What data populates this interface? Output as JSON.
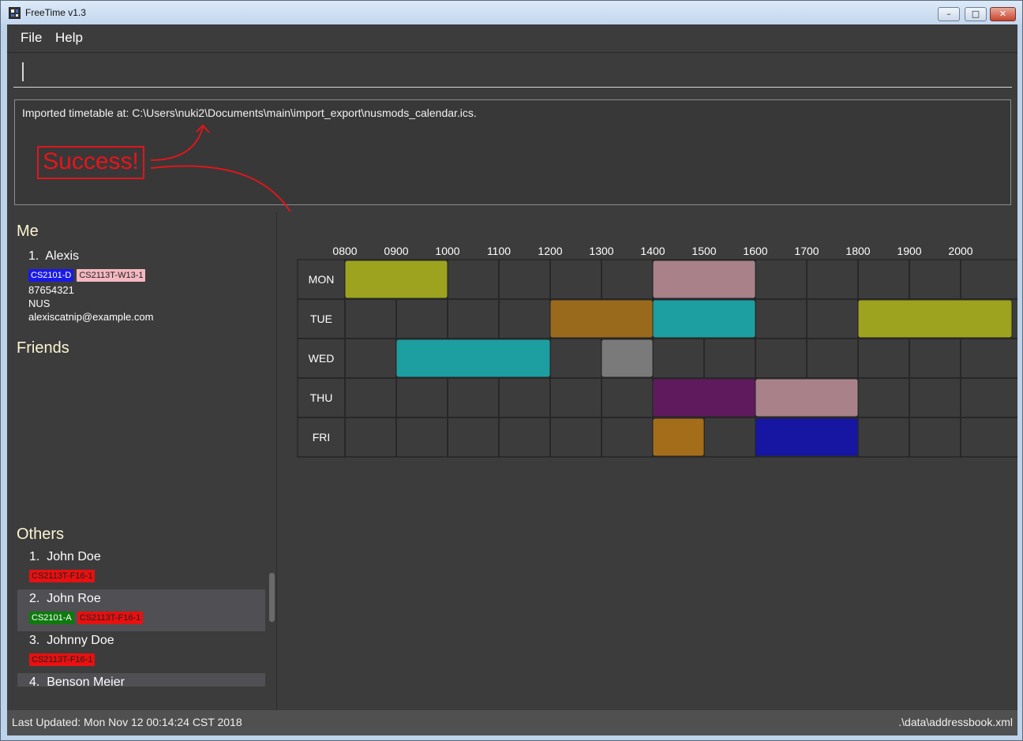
{
  "window": {
    "title": "FreeTime v1.3",
    "min_symbol": "–",
    "max_symbol": "□",
    "close_symbol": "✕"
  },
  "menu": {
    "file": "File",
    "help": "Help"
  },
  "command_box": {
    "value": ""
  },
  "result": {
    "text": "Imported timetable at: C:\\Users\\nuki2\\Documents\\main\\import_export\\nusmods_calendar.ics.",
    "annotation": "Success!",
    "annotation_color": "#e0161c"
  },
  "me": {
    "title": "Me",
    "index": "1.",
    "name": "Alexis",
    "tags": [
      {
        "label": "CS2101-D",
        "bg": "#1a1ae6",
        "fg": "#ffffff"
      },
      {
        "label": "CS2113T-W13-1",
        "bg": "#f4b8c0",
        "fg": "#222222"
      }
    ],
    "phone": "87654321",
    "address": "NUS",
    "email": "alexiscatnip@example.com"
  },
  "friends": {
    "title": "Friends"
  },
  "others": {
    "title": "Others",
    "list": [
      {
        "index": "1.",
        "name": "John Doe",
        "tags": [
          {
            "label": "CS2113T-F16-1",
            "bg": "#e81010",
            "fg": "#222222"
          }
        ]
      },
      {
        "index": "2.",
        "name": "John Roe",
        "tags": [
          {
            "label": "CS2101-A",
            "bg": "#0e7a0e",
            "fg": "#ffffff"
          },
          {
            "label": "CS2113T-F16-1",
            "bg": "#e81010",
            "fg": "#222222"
          }
        ]
      },
      {
        "index": "3.",
        "name": "Johnny Doe",
        "tags": [
          {
            "label": "CS2113T-F16-1",
            "bg": "#e81010",
            "fg": "#222222"
          }
        ]
      },
      {
        "index": "4.",
        "name": "Benson Meier",
        "tags": []
      }
    ]
  },
  "timetable": {
    "hours": [
      "0800",
      "0900",
      "1000",
      "1100",
      "1200",
      "1300",
      "1400",
      "1500",
      "1600",
      "1700",
      "1800",
      "1900",
      "2000"
    ],
    "days": [
      "MON",
      "TUE",
      "WED",
      "THU",
      "FRI"
    ],
    "slots": [
      {
        "day": "MON",
        "start": 800,
        "end": 1000,
        "color": "#9ea31f"
      },
      {
        "day": "MON",
        "start": 1400,
        "end": 1600,
        "color": "#a88189"
      },
      {
        "day": "TUE",
        "start": 1200,
        "end": 1400,
        "color": "#9a6a1c"
      },
      {
        "day": "TUE",
        "start": 1400,
        "end": 1600,
        "color": "#1d9ea0"
      },
      {
        "day": "TUE",
        "start": 1800,
        "end": 2100,
        "color": "#9ea31f"
      },
      {
        "day": "WED",
        "start": 900,
        "end": 1200,
        "color": "#1d9ea0"
      },
      {
        "day": "WED",
        "start": 1300,
        "end": 1400,
        "color": "#7a7a7a"
      },
      {
        "day": "THU",
        "start": 1400,
        "end": 1600,
        "color": "#5e1a5c"
      },
      {
        "day": "THU",
        "start": 1600,
        "end": 1800,
        "color": "#a88189"
      },
      {
        "day": "FRI",
        "start": 1400,
        "end": 1500,
        "color": "#a46d1a"
      },
      {
        "day": "FRI",
        "start": 1600,
        "end": 1800,
        "color": "#1616a2"
      }
    ]
  },
  "status": {
    "last_updated": "Last Updated: Mon Nov 12 00:14:24 CST 2018",
    "file_path": ".\\data\\addressbook.xml"
  }
}
